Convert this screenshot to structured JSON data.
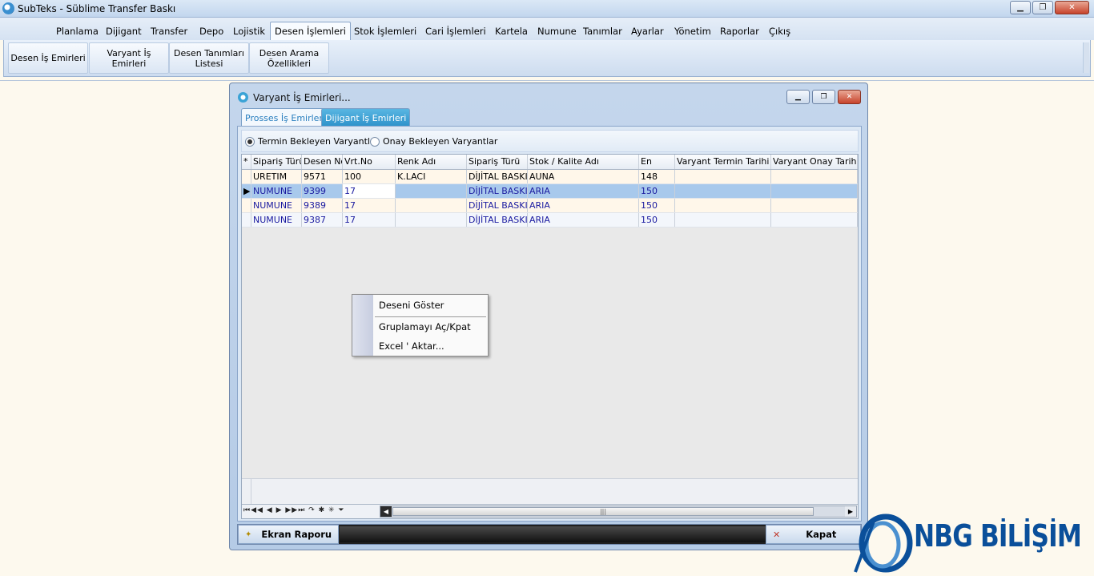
{
  "window": {
    "title": "SubTeks - Süblime Transfer Baskı",
    "controls": {
      "minimize": "▁",
      "maximize": "❐",
      "close": "✕"
    }
  },
  "menu": {
    "items": [
      "Planlama",
      "Dijigant",
      "Transfer",
      "Depo",
      "Lojistik",
      "Desen İşlemleri",
      "Stok İşlemleri",
      "Cari İşlemleri",
      "Kartela",
      "Numune",
      "Tanımlar",
      "Ayarlar",
      "Yönetim",
      "Raporlar",
      "Çıkış"
    ],
    "active": "Desen İşlemleri"
  },
  "ribbon": {
    "buttons": [
      "Desen İş Emirleri",
      "Varyant İş Emirleri",
      "Desen Tanımları Listesi",
      "Desen Arama Özellikleri"
    ]
  },
  "dialog": {
    "title": "Varyant İş Emirleri...",
    "tabs": [
      "Prosses İş Emirleri",
      "Dijigant İş Emirleri"
    ],
    "active_tab": "Prosses İş Emirleri",
    "radios": [
      {
        "label": "Termin Bekleyen Varyantlar",
        "checked": true
      },
      {
        "label": "Onay Bekleyen Varyantlar",
        "checked": false
      }
    ],
    "grid": {
      "indicator_header": "*",
      "columns": [
        "Sipariş Türü",
        "Desen No",
        "Vrt.No",
        "Renk Adı",
        "Sipariş Türü",
        "Stok / Kalite Adı",
        "En",
        "Varyant Termin Tarihi",
        "Varyant Onay Tarihi"
      ],
      "rows": [
        {
          "cells": [
            "URETIM",
            "9571",
            "100",
            "K.LACI",
            "DİJİTAL BASKI",
            "AUNA",
            "148",
            "",
            ""
          ],
          "indicator": ""
        },
        {
          "cells": [
            "NUMUNE",
            "9399",
            "17",
            "",
            "DİJİTAL BASKI",
            "ARIA",
            "150",
            "",
            ""
          ],
          "indicator": "▶"
        },
        {
          "cells": [
            "NUMUNE",
            "9389",
            "17",
            "",
            "DİJİTAL BASKI",
            "ARIA",
            "150",
            "",
            ""
          ],
          "indicator": ""
        },
        {
          "cells": [
            "NUMUNE",
            "9387",
            "17",
            "",
            "DİJİTAL BASKI",
            "ARIA",
            "150",
            "",
            ""
          ],
          "indicator": ""
        }
      ],
      "selected_row": 1,
      "navigator": "⏮◀◀ ◀ ▶ ▶▶⏭ ↷ ✱ ✳ ⏷",
      "scroll_grip": "|||"
    },
    "context_menu": [
      "Deseni Göster",
      "Gruplamayı Aç/Kpat",
      "Excel ' Aktar..."
    ],
    "buttons": {
      "report": "Ekran Raporu",
      "close": "Kapat"
    }
  },
  "logo": {
    "text": "NBG BİLİŞİM"
  },
  "colors": {
    "accent": "#2a7fbf",
    "logo": "#0a4f9a",
    "selected_row": "#a8c9ec"
  }
}
